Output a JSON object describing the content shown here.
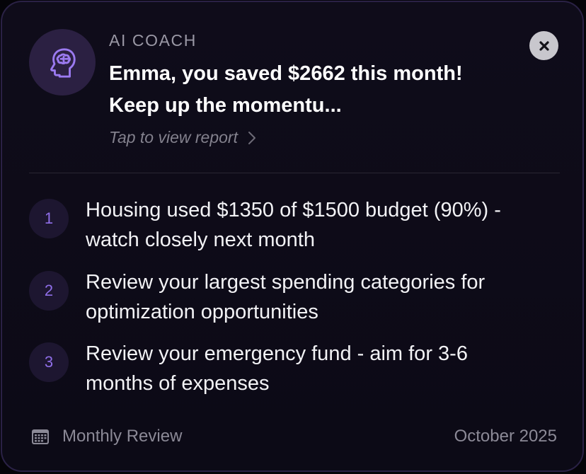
{
  "header": {
    "eyebrow": "AI COACH",
    "headline": "Emma, you saved $2662 this month! Keep up the momentu...",
    "tap_label": "Tap to view report",
    "avatar_icon": "brain-head-icon",
    "close_icon": "close-icon"
  },
  "tips": [
    {
      "number": "1",
      "text": "Housing used $1350 of $1500 budget (90%) - watch closely next month"
    },
    {
      "number": "2",
      "text": "Review your largest spending categories for optimization opportunities"
    },
    {
      "number": "3",
      "text": "Review your emergency fund - aim for 3-6 months of expenses"
    }
  ],
  "footer": {
    "icon": "calendar-icon",
    "label": "Monthly Review",
    "date": "October 2025"
  },
  "colors": {
    "accent": "#8f6ee8",
    "background": "#0d0b17",
    "border": "#2a2145"
  }
}
